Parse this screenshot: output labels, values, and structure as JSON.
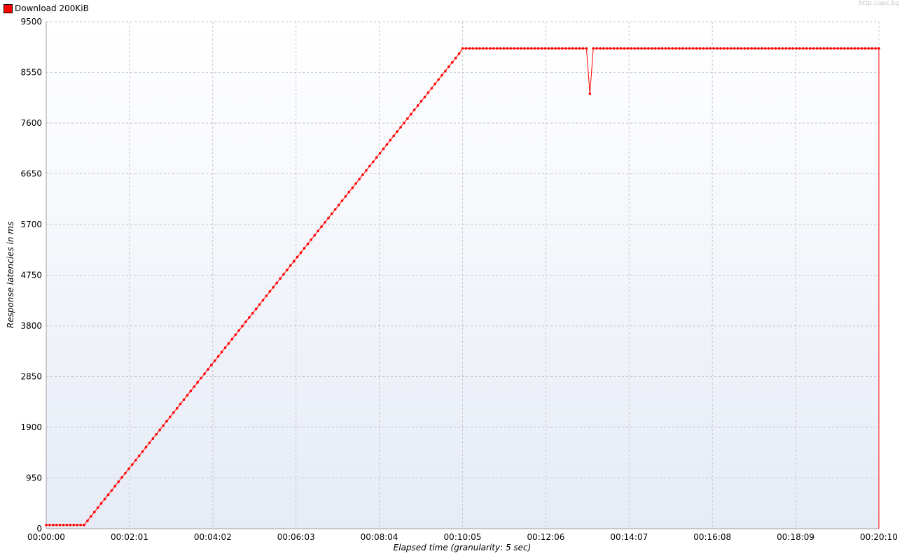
{
  "watermark": "http://apc.kg",
  "colors": {
    "series": "#ff0000",
    "grid": "#c6c6cc",
    "axis": "#a0a0a0"
  },
  "chart_data": {
    "type": "line",
    "title": "",
    "xlabel": "Elapsed time (granularity: 5 sec)",
    "ylabel": "Response latencies in ms",
    "ylim": [
      0,
      9500
    ],
    "xlim": [
      "00:00:00",
      "00:20:10"
    ],
    "grid": true,
    "legend_position": "top-left",
    "y_ticks": [
      "0",
      "950",
      "1900",
      "2850",
      "3800",
      "4750",
      "5700",
      "6650",
      "7600",
      "8550",
      "9500"
    ],
    "x_ticks": [
      "00:00:00",
      "00:02:01",
      "00:04:02",
      "00:06:03",
      "00:08:04",
      "00:10:05",
      "00:12:06",
      "00:14:07",
      "00:16:08",
      "00:18:09",
      "00:20:10"
    ],
    "series": [
      {
        "name": "Download 200KiB",
        "color": "#ff0000",
        "points": [
          [
            "00:00:00",
            70
          ],
          [
            "00:00:55",
            70
          ],
          [
            "00:01:00",
            150
          ],
          [
            "00:10:00",
            8900
          ],
          [
            "00:10:05",
            9000
          ],
          [
            "00:13:05",
            9000
          ],
          [
            "00:13:10",
            8150
          ],
          [
            "00:13:15",
            9000
          ],
          [
            "00:20:10",
            9000
          ],
          [
            "00:20:10",
            0
          ]
        ]
      }
    ]
  }
}
